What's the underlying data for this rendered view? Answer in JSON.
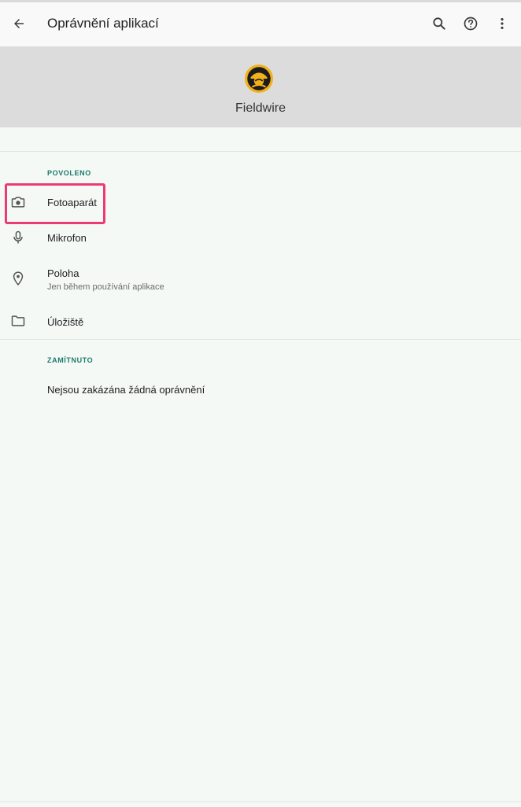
{
  "appbar": {
    "title": "Oprávnění aplikací",
    "back_icon": "arrow-left-icon",
    "actions": [
      "search-icon",
      "help-icon",
      "more-vert-icon"
    ]
  },
  "app": {
    "name": "Fieldwire",
    "logo_colors": {
      "ring": "#f2b11b",
      "inner": "#1c1c1c"
    }
  },
  "allowed": {
    "label": "POVOLENO",
    "items": [
      {
        "label": "Fotoaparát",
        "icon": "camera-icon"
      },
      {
        "label": "Mikrofon",
        "icon": "microphone-icon"
      },
      {
        "label": "Poloha",
        "sublabel": "Jen během používání aplikace",
        "icon": "location-pin-icon"
      },
      {
        "label": "Úložiště",
        "icon": "folder-icon"
      }
    ]
  },
  "denied": {
    "label": "ZAMÍTNUTO",
    "empty_text": "Nejsou zakázána žádná oprávnění"
  },
  "colors": {
    "accent_label": "#1a7a6b",
    "highlight": "#ec3a78",
    "header_band": "#dcdcdc"
  }
}
